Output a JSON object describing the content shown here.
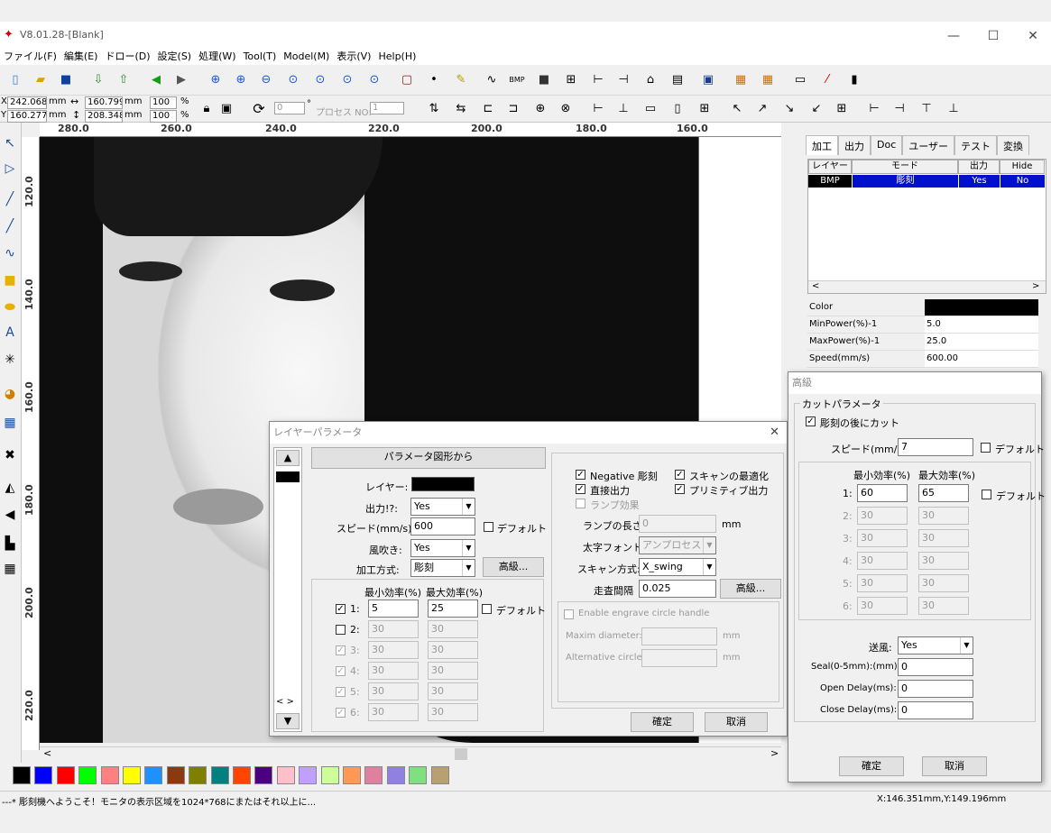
{
  "app": {
    "title": "V8.01.28-[Blank]"
  },
  "window_controls": {
    "minimize": "—",
    "maximize": "☐",
    "close": "✕"
  },
  "menu": [
    "ファイル(F)",
    "編集(E)",
    "ドロー(D)",
    "設定(S)",
    "処理(W)",
    "Tool(T)",
    "Model(M)",
    "表示(V)",
    "Help(H)"
  ],
  "toolbar2": {
    "x_label": "X",
    "x_value": "242.068",
    "x_unit": "mm",
    "y_label": "Y",
    "y_value": "160.277",
    "y_unit": "mm",
    "w_value": "160.799",
    "w_unit": "mm",
    "h_value": "208.348",
    "h_unit": "mm",
    "pct_w": "100",
    "pct_h": "100",
    "pct_unit": "%",
    "rotate_value": "0",
    "rotate_unit": "°",
    "process_label": "プロセス NO:",
    "process_value": "1"
  },
  "ruler_top": [
    "280.0",
    "260.0",
    "240.0",
    "220.0",
    "200.0",
    "180.0",
    "160.0"
  ],
  "ruler_left": [
    "120.0",
    "140.0",
    "160.0",
    "180.0",
    "200.0",
    "220.0"
  ],
  "right_panel": {
    "tabs": [
      "加工",
      "出力",
      "Doc",
      "ユーザー",
      "テスト",
      "変換"
    ],
    "columns": [
      "レイヤー",
      "モード",
      "出力",
      "Hide"
    ],
    "row": {
      "layer": "BMP",
      "mode": "彫刻",
      "output": "Yes",
      "hide": "No"
    },
    "props": [
      {
        "k": "Color",
        "v": ""
      },
      {
        "k": "MinPower(%)-1",
        "v": "5.0"
      },
      {
        "k": "MaxPower(%)-1",
        "v": "25.0"
      },
      {
        "k": "Speed(mm/s)",
        "v": "600.00"
      }
    ]
  },
  "layer_dialog": {
    "title": "レイヤーパラメータ",
    "from_shape_button": "パラメータ図形から",
    "layer_label": "レイヤー:",
    "output_label": "出力!?:",
    "output_value": "Yes",
    "speed_label": "スピード(mm/s):",
    "speed_value": "600",
    "default_label": "デフォルト",
    "blow_label": "風吹き:",
    "blow_value": "Yes",
    "method_label": "加工方式:",
    "method_value": "彫刻",
    "advanced_button": "高級...",
    "min_header": "最小効率(%)",
    "max_header": "最大効率(%)",
    "power_rows": [
      {
        "n": "1:",
        "min": "5",
        "max": "25",
        "checked": true,
        "enabled": true
      },
      {
        "n": "2:",
        "min": "30",
        "max": "30",
        "checked": false,
        "enabled": true
      },
      {
        "n": "3:",
        "min": "30",
        "max": "30",
        "checked": true,
        "enabled": false
      },
      {
        "n": "4:",
        "min": "30",
        "max": "30",
        "checked": true,
        "enabled": false
      },
      {
        "n": "5:",
        "min": "30",
        "max": "30",
        "checked": true,
        "enabled": false
      },
      {
        "n": "6:",
        "min": "30",
        "max": "30",
        "checked": true,
        "enabled": false
      }
    ],
    "negative_label": "Negative 彫刻",
    "scan_opt_label": "スキャンの最適化",
    "direct_label": "直接出力",
    "primitive_label": "プリミティブ出力",
    "ramp_label": "ランプ効果",
    "ramp_len_label": "ランプの長さ:",
    "ramp_len_value": "0",
    "ramp_len_unit": "mm",
    "bold_font_label": "太字フォント:",
    "bold_font_value": "アンプロセス",
    "scan_method_label": "スキャン方式:",
    "scan_method_value": "X_swing",
    "scan_gap_label": "走査間隔",
    "scan_gap_value": "0.025",
    "scan_advanced": "高級...",
    "circle_label": "Enable engrave circle handle",
    "maxim_label": "Maxim diameter:",
    "maxim_unit": "mm",
    "alt_label": "Alternative circle",
    "alt_unit": "mm",
    "ok": "確定",
    "cancel": "取消"
  },
  "advanced_dialog": {
    "title": "高級",
    "group_title": "カットパラメータ",
    "cut_after_label": "彫刻の後にカット",
    "speed_label": "スピード(mm/s)",
    "speed_value": "7",
    "default_label": "デフォルト",
    "min_header": "最小効率(%)",
    "max_header": "最大効率(%)",
    "rows": [
      {
        "n": "1:",
        "min": "60",
        "max": "65",
        "enabled": true
      },
      {
        "n": "2:",
        "min": "30",
        "max": "30",
        "enabled": false
      },
      {
        "n": "3:",
        "min": "30",
        "max": "30",
        "enabled": false
      },
      {
        "n": "4:",
        "min": "30",
        "max": "30",
        "enabled": false
      },
      {
        "n": "5:",
        "min": "30",
        "max": "30",
        "enabled": false
      },
      {
        "n": "6:",
        "min": "30",
        "max": "30",
        "enabled": false
      }
    ],
    "blow_label": "送風:",
    "blow_value": "Yes",
    "seal_label": "Seal(0-5mm):(mm):",
    "seal_value": "0",
    "open_label": "Open Delay(ms):",
    "open_value": "0",
    "close_label": "Close Delay(ms):",
    "close_value": "0",
    "ok": "確定",
    "cancel": "取消"
  },
  "palette": [
    "#000000",
    "#0000ff",
    "#ff0000",
    "#00ff00",
    "#ff8080",
    "#ffff00",
    "#1e90ff",
    "#8b3a0f",
    "#808000",
    "#008080",
    "#ff4500",
    "#4b0082",
    "#ffc0cb",
    "#c0a0ff",
    "#ccff99",
    "#ff9955",
    "#e080a0",
    "#9080e0",
    "#80e080",
    "#b8a070"
  ],
  "status": {
    "message": "---* 彫刻機へようこそ！モニタの表示区域を1024*768にまたはそれ以上に...",
    "coords": "X:146.351mm,Y:149.196mm"
  }
}
